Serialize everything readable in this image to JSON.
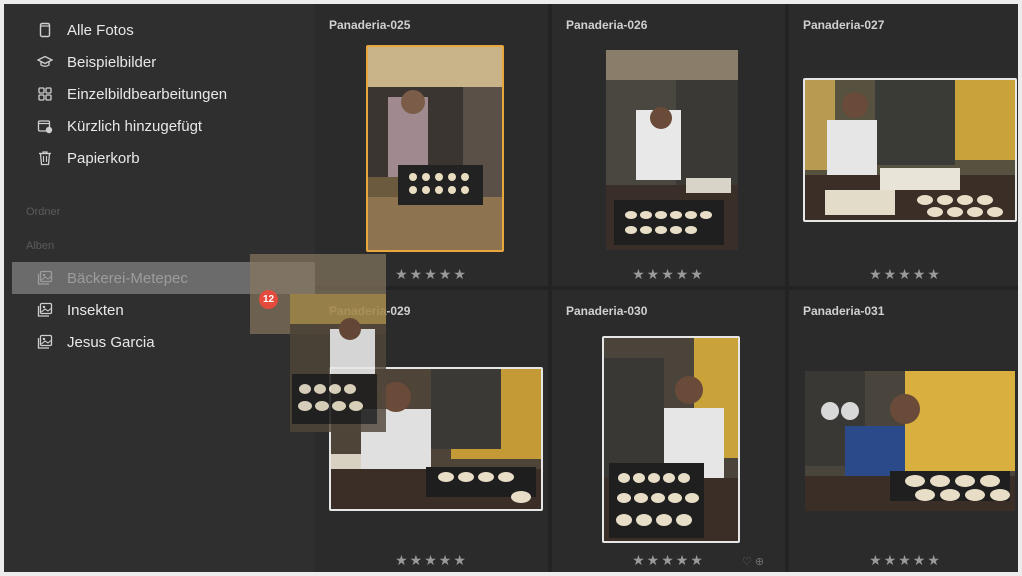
{
  "sidebar": {
    "library_items": [
      {
        "label": "Alle Fotos",
        "icon": "phone-icon"
      },
      {
        "label": "Beispielbilder",
        "icon": "graduation-cap-icon"
      },
      {
        "label": "Einzelbildbearbeitungen",
        "icon": "grid-icon"
      },
      {
        "label": "Kürzlich hinzugefügt",
        "icon": "recent-icon"
      },
      {
        "label": "Papierkorb",
        "icon": "trash-icon"
      }
    ],
    "folders_label": "Ordner",
    "albums_label": "Alben",
    "albums": [
      {
        "label": "Bäckerei-Metepec",
        "icon": "album-icon",
        "selected": true
      },
      {
        "label": "Insekten",
        "icon": "album-icon"
      },
      {
        "label": "Jesus Garcia",
        "icon": "album-icon"
      }
    ]
  },
  "grid": {
    "photos": [
      {
        "title": "Panaderia-025",
        "rating": "★★★★★",
        "selected": true
      },
      {
        "title": "Panaderia-026",
        "rating": "★★★★★"
      },
      {
        "title": "Panaderia-027",
        "rating": "★★★★★"
      },
      {
        "title": "Panaderia-029",
        "rating": "★★★★★"
      },
      {
        "title": "Panaderia-030",
        "rating": "★★★★★",
        "extra": "♡ ⊕"
      },
      {
        "title": "Panaderia-031",
        "rating": "★★★★★"
      }
    ]
  },
  "drag": {
    "count": "12"
  },
  "colors": {
    "selection": "#e9a63c",
    "badge": "#e54b3c"
  }
}
